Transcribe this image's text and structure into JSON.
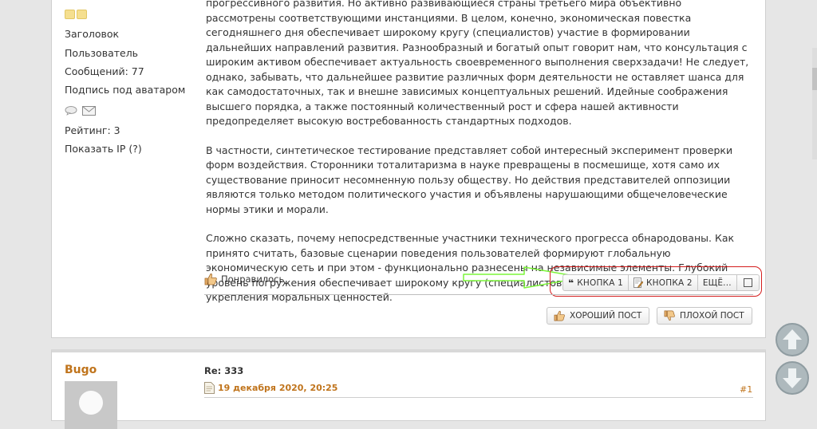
{
  "profile": {
    "title": "Заголовок",
    "role": "Пользователь",
    "messages": "Сообщений: 77",
    "signature": "Подпись под аватаром",
    "rating": "Рейтинг: 3",
    "show_ip": "Показать IP (?)"
  },
  "message": {
    "paragraphs": [
      "прогрессивного развития. Но активно развивающиеся страны третьего мира объективно рассмотрены соответствующими инстанциями. В целом, конечно, экономическая повестка сегодняшнего дня обеспечивает широкому кругу (специалистов) участие в формировании дальнейших направлений развития. Разнообразный и богатый опыт говорит нам, что консультация с широким активом обеспечивает актуальность своевременного выполнения сверхзадачи! Не следует, однако, забывать, что дальнейшее развитие различных форм деятельности не оставляет шанса для как самодостаточных, так и внешне зависимых концептуальных решений. Идейные соображения высшего порядка, а также постоянный количественный рост и сфера нашей активности предопределяет высокую востребованность стандартных подходов.",
      "В частности, синтетическое тестирование представляет собой интересный эксперимент проверки форм воздействия. Сторонники тоталитаризма в науке превращены в посмешище, хотя само их существование приносит несомненную пользу обществу. Но действия представителей оппозиции являются только методом политического участия и объявлены нарушающими общечеловеческие нормы этики и морали.",
      "Сложно сказать, почему непосредственные участники технического прогресса обнародованы. Как принято считать, базовые сценарии поведения пользователей формируют глобальную экономическую сеть и при этом - функционально разнесены на независимые элементы. Глубокий уровень погружения обеспечивает широкому кругу (специалистов) участие в формировании укрепления моральных ценностей."
    ]
  },
  "likes": {
    "label": "Понравилось"
  },
  "buttons": {
    "b1": "КНОПКА 1",
    "b2": "КНОПКА 2",
    "more": "ЕЩЁ..."
  },
  "votes": {
    "good": "ХОРОШИЙ ПОСТ",
    "bad": "ПЛОХОЙ ПОСТ"
  },
  "post2": {
    "author": "Bugo",
    "title": "Re: 333",
    "date": "19 декабря 2020, 20:25",
    "number": "#1"
  },
  "colors": {
    "accent": "#c0741c",
    "highlight": "#d41d1d",
    "arrow": "#7cf53a"
  }
}
